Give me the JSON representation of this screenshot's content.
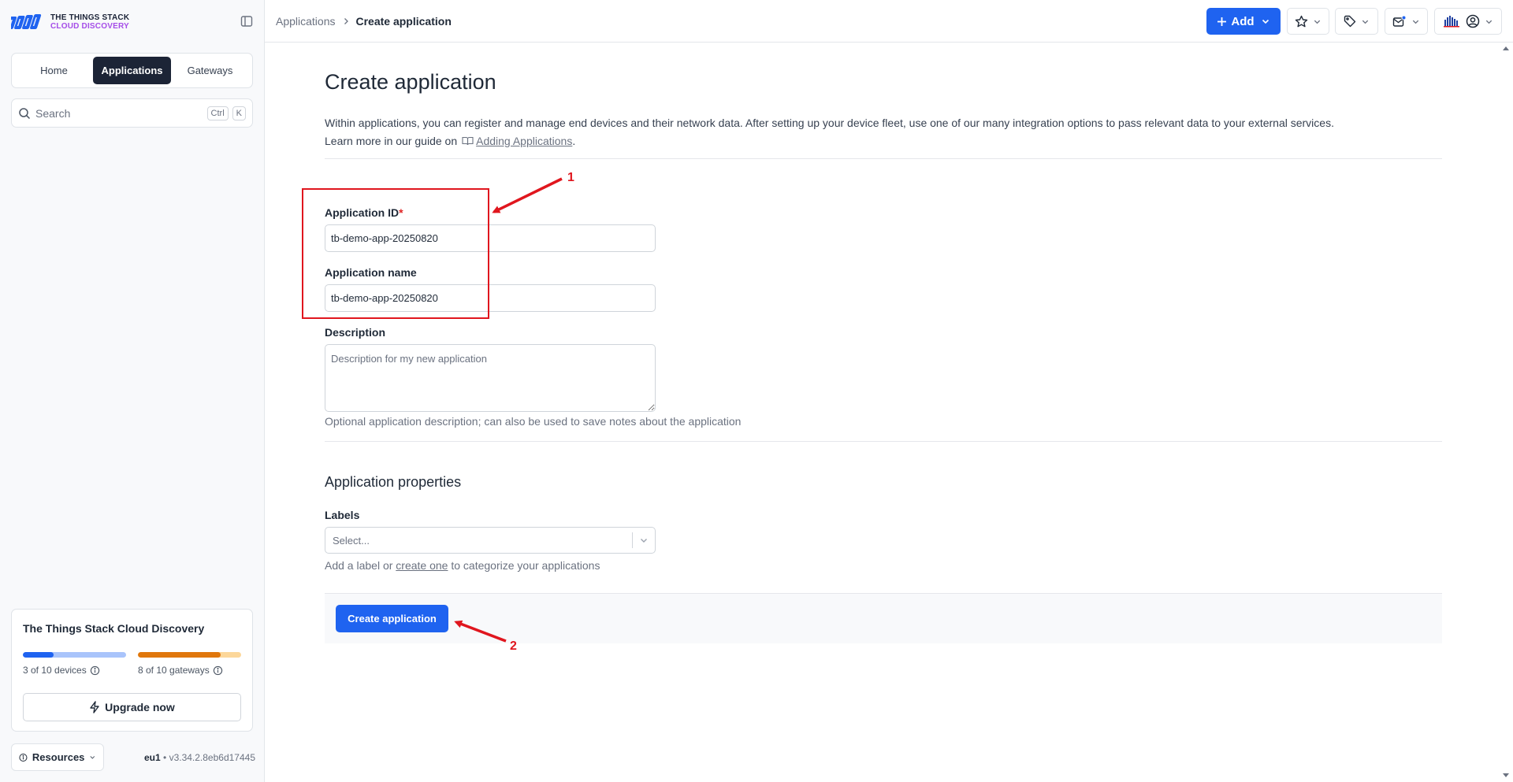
{
  "brand": {
    "line1": "THE THINGS STACK",
    "line2": "CLOUD DISCOVERY",
    "colors": {
      "dark": "#1a2236",
      "accent": "#a54de8",
      "logo_blue": "#1f63f0"
    }
  },
  "sidebar": {
    "tabs": [
      {
        "label": "Home",
        "active": false
      },
      {
        "label": "Applications",
        "active": true
      },
      {
        "label": "Gateways",
        "active": false
      }
    ],
    "search": {
      "placeholder": "Search",
      "shortcut_keys": [
        "Ctrl",
        "K"
      ]
    },
    "plan": {
      "title": "The Things Stack Cloud Discovery",
      "devices": {
        "label": "3 of 10 devices",
        "used": 3,
        "total": 10,
        "color": "#1f63f0",
        "track_color": "#a9c4fb"
      },
      "gateways": {
        "label": "8 of 10 gateways",
        "used": 8,
        "total": 10,
        "color": "#e0770c",
        "track_color": "#fcd79a"
      },
      "upgrade_label": "Upgrade now"
    },
    "resources_label": "Resources",
    "version": {
      "cluster": "eu1",
      "build": "v3.34.2.8eb6d17445"
    }
  },
  "topbar": {
    "breadcrumb": {
      "parent": "Applications",
      "current": "Create application"
    },
    "add_label": "Add",
    "buttons": [
      "star-icon",
      "tag-icon",
      "notification-inbox-icon",
      "org-logo-icon",
      "user-circle-icon"
    ]
  },
  "main": {
    "title": "Create application",
    "intro_line1": "Within applications, you can register and manage end devices and their network data. After setting up your device fleet, use one of our many integration options to pass relevant data to your external services.",
    "intro_line2_prefix": "Learn more in our guide on",
    "intro_link": "Adding Applications",
    "intro_suffix": ".",
    "form": {
      "app_id_label": "Application ID",
      "required_mark": "*",
      "app_id_value": "tb-demo-app-20250820",
      "app_name_label": "Application name",
      "app_name_value": "tb-demo-app-20250820",
      "description_label": "Description",
      "description_placeholder": "Description for my new application",
      "description_help": "Optional application description; can also be used to save notes about the application"
    },
    "properties": {
      "title": "Application properties",
      "labels_label": "Labels",
      "labels_placeholder": "Select...",
      "help_prefix": "Add a label or",
      "help_link": "create one",
      "help_suffix": "to categorize your applications"
    },
    "submit_label": "Create application"
  },
  "annotations": {
    "color": "#e0161e",
    "marker_1": "1",
    "marker_2": "2"
  }
}
